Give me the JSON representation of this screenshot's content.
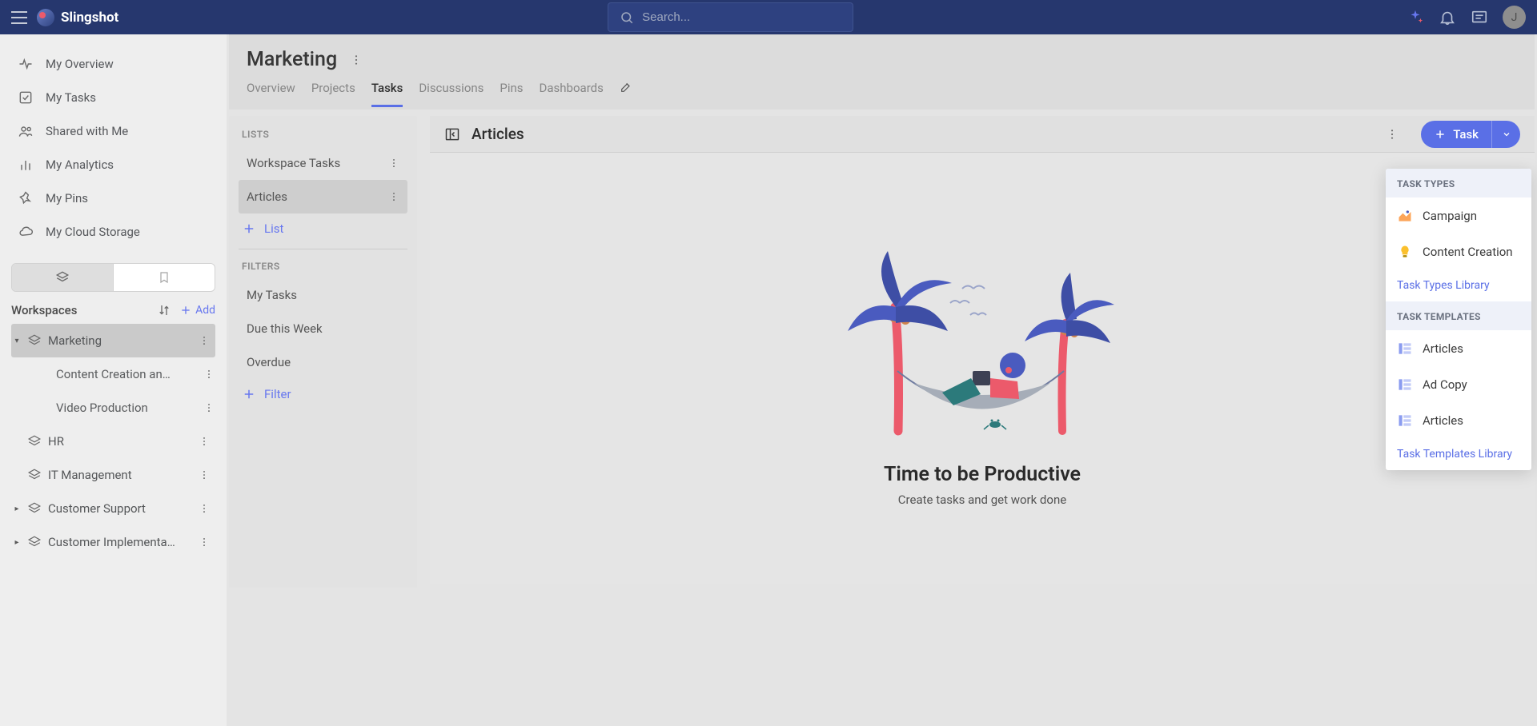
{
  "app_name": "Slingshot",
  "search": {
    "placeholder": "Search..."
  },
  "avatar_initial": "J",
  "nav": [
    {
      "label": "My Overview",
      "icon": "activity"
    },
    {
      "label": "My Tasks",
      "icon": "check-square"
    },
    {
      "label": "Shared with Me",
      "icon": "users"
    },
    {
      "label": "My Analytics",
      "icon": "bar-chart"
    },
    {
      "label": "My Pins",
      "icon": "pin"
    },
    {
      "label": "My Cloud Storage",
      "icon": "cloud"
    }
  ],
  "workspaces_header": {
    "label": "Workspaces",
    "add": "Add"
  },
  "workspaces": [
    {
      "label": "Marketing",
      "active": true,
      "expanded": true,
      "children": [
        {
          "label": "Content Creation an…"
        },
        {
          "label": "Video Production"
        }
      ]
    },
    {
      "label": "HR",
      "active": false,
      "expanded": false,
      "caret": false
    },
    {
      "label": "IT Management",
      "active": false,
      "expanded": false,
      "caret": false
    },
    {
      "label": "Customer Support",
      "active": false,
      "expanded": false,
      "caret": true
    },
    {
      "label": "Customer Implementa…",
      "active": false,
      "expanded": false,
      "caret": true
    }
  ],
  "page": {
    "title": "Marketing",
    "tabs": [
      "Overview",
      "Projects",
      "Tasks",
      "Discussions",
      "Pins",
      "Dashboards"
    ],
    "active_tab": "Tasks"
  },
  "lists_panel": {
    "lists_heading": "LISTS",
    "lists": [
      {
        "label": "Workspace Tasks",
        "active": false
      },
      {
        "label": "Articles",
        "active": true
      }
    ],
    "add_list": "List",
    "filters_heading": "FILTERS",
    "filters": [
      {
        "label": "My Tasks"
      },
      {
        "label": "Due this Week"
      },
      {
        "label": "Overdue"
      }
    ],
    "add_filter": "Filter"
  },
  "main_panel": {
    "title": "Articles",
    "task_button": "Task"
  },
  "empty": {
    "title": "Time to be Productive",
    "subtitle": "Create tasks and get work done"
  },
  "dropdown": {
    "types_heading": "TASK TYPES",
    "types": [
      {
        "label": "Campaign",
        "color": "#fca55a"
      },
      {
        "label": "Content Creation",
        "color": "#fbc02d"
      }
    ],
    "types_link": "Task Types Library",
    "templates_heading": "TASK TEMPLATES",
    "templates": [
      {
        "label": "Articles"
      },
      {
        "label": "Ad Copy"
      },
      {
        "label": "Articles"
      }
    ],
    "templates_link": "Task Templates Library"
  }
}
